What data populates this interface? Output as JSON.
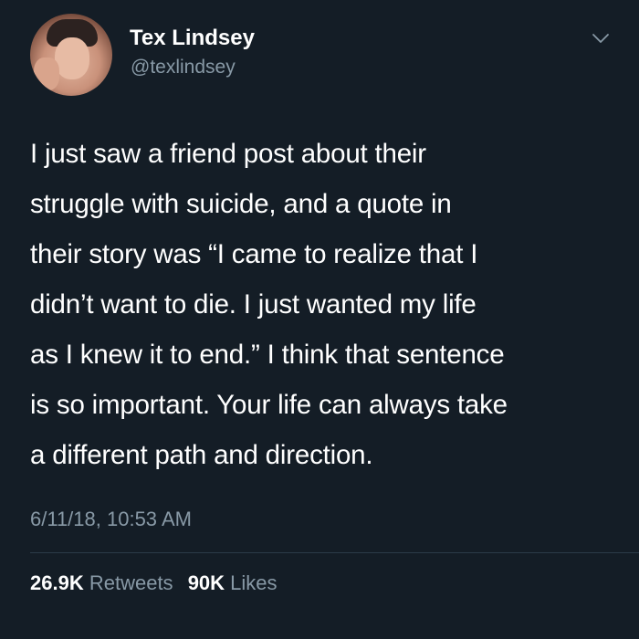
{
  "author": {
    "display_name": "Tex Lindsey",
    "handle": "@texlindsey",
    "avatar_icon": "profile-photo"
  },
  "menu": {
    "icon": "chevron-down-icon"
  },
  "tweet": {
    "lines": [
      "I just saw a friend post about their",
      "struggle with suicide, and a quote in",
      "their story was “I came to realize that I",
      "didn’t want to die. I just wanted my life",
      "as I knew it to end.” I think that sentence",
      "is so important. Your life can always take",
      "a different path and direction."
    ],
    "timestamp": "6/11/18, 10:53 AM"
  },
  "stats": {
    "retweets_count": "26.9K",
    "retweets_label": "Retweets",
    "likes_count": "90K",
    "likes_label": "Likes"
  },
  "colors": {
    "background": "#141d26",
    "text_primary": "#ffffff",
    "text_secondary": "#8899a6",
    "divider": "#2b3a48"
  }
}
